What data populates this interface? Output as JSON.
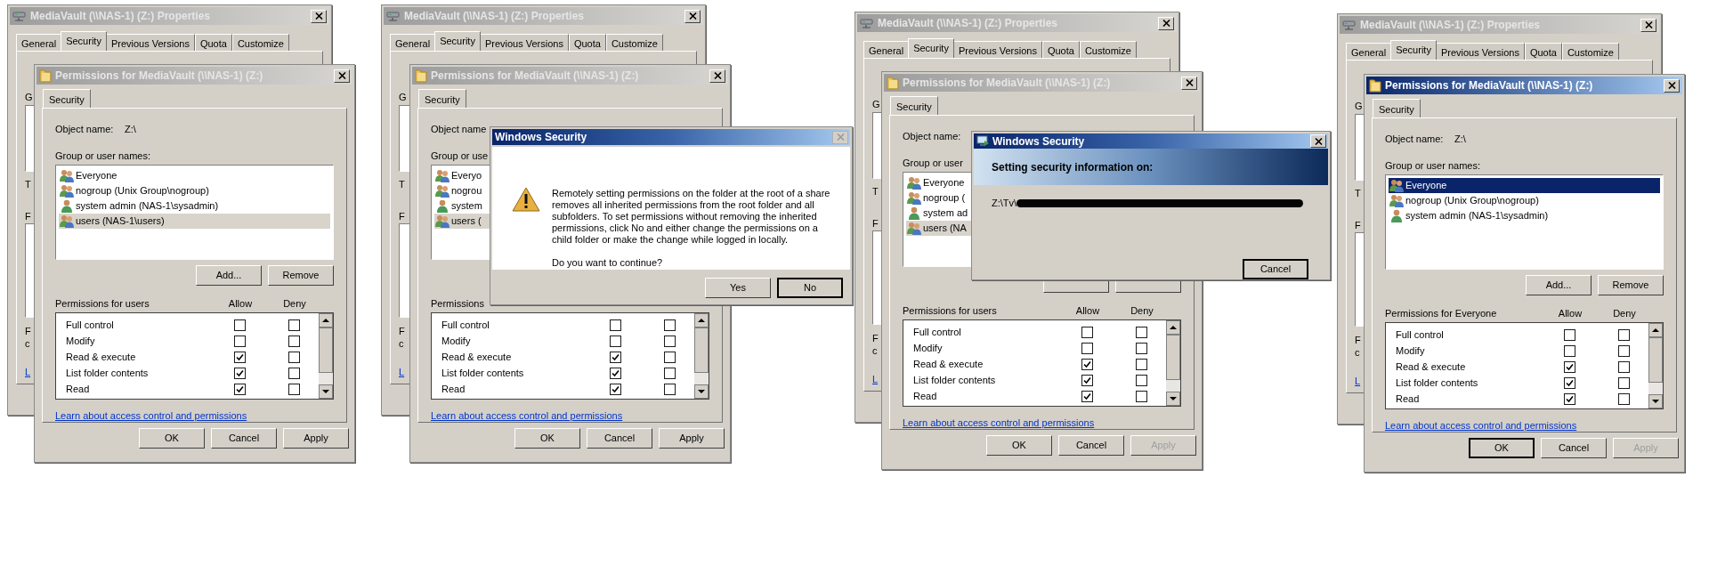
{
  "panels": [
    {
      "properties_window": {
        "title": "MediaVault (\\\\NAS-1) (Z:) Properties",
        "active": false,
        "tabs": [
          {
            "label": "General",
            "selected": false
          },
          {
            "label": "Security",
            "selected": true
          },
          {
            "label": "Previous Versions",
            "selected": false
          },
          {
            "label": "Quota",
            "selected": false
          },
          {
            "label": "Customize",
            "selected": false
          }
        ],
        "fragments": [
          {
            "kind": "label",
            "text": "G"
          },
          {
            "kind": "box"
          },
          {
            "kind": "label",
            "text": "T"
          },
          {
            "kind": "label",
            "text": "F"
          },
          {
            "kind": "box"
          },
          {
            "kind": "label",
            "text": "F"
          },
          {
            "kind": "label",
            "text": "c"
          },
          {
            "kind": "link",
            "text": "L"
          }
        ]
      },
      "permissions_window": {
        "title": "Permissions for MediaVault (\\\\NAS-1) (Z:)",
        "active": false,
        "tab": "Security",
        "object_label": "Object name:",
        "object_value": "Z:\\",
        "group_label": "Group or user names:",
        "users": [
          {
            "name": "Everyone",
            "kind": "group",
            "selected": false
          },
          {
            "name": "nogroup (Unix Group\\nogroup)",
            "kind": "group",
            "selected": false
          },
          {
            "name": "system admin (NAS-1\\sysadmin)",
            "kind": "user",
            "selected": false
          },
          {
            "name": "users (NAS-1\\users)",
            "kind": "group",
            "selected": true
          }
        ],
        "action_buttons": [
          "Add...",
          "Remove"
        ],
        "permissions_label": "Permissions for users",
        "allow_header": "Allow",
        "deny_header": "Deny",
        "permissions": [
          {
            "name": "Full control",
            "allow": false,
            "deny": false
          },
          {
            "name": "Modify",
            "allow": false,
            "deny": false
          },
          {
            "name": "Read & execute",
            "allow": true,
            "deny": false
          },
          {
            "name": "List folder contents",
            "allow": true,
            "deny": false
          },
          {
            "name": "Read",
            "allow": true,
            "deny": false
          }
        ],
        "link": "Learn about access control and permissions",
        "buttons": [
          {
            "label": "OK",
            "default": false,
            "disabled": false
          },
          {
            "label": "Cancel",
            "default": false,
            "disabled": false
          },
          {
            "label": "Apply",
            "default": false,
            "disabled": false
          }
        ]
      }
    },
    {
      "properties_window": {
        "title": "MediaVault (\\\\NAS-1) (Z:) Properties",
        "active": false,
        "tabs": [
          {
            "label": "General",
            "selected": false
          },
          {
            "label": "Security",
            "selected": true
          },
          {
            "label": "Previous Versions",
            "selected": false
          },
          {
            "label": "Quota",
            "selected": false
          },
          {
            "label": "Customize",
            "selected": false
          }
        ],
        "fragments": [
          {
            "kind": "label",
            "text": "G"
          },
          {
            "kind": "box"
          },
          {
            "kind": "label",
            "text": "T"
          },
          {
            "kind": "label",
            "text": "F"
          },
          {
            "kind": "box"
          },
          {
            "kind": "label",
            "text": "F"
          },
          {
            "kind": "label",
            "text": "c"
          },
          {
            "kind": "link",
            "text": "L"
          }
        ]
      },
      "permissions_window": {
        "title": "Permissions for MediaVault (\\\\NAS-1) (Z:)",
        "active": false,
        "tab": "Security",
        "object_label": "Object name",
        "group_label": "Group or use",
        "users": [
          {
            "name": "Everyo",
            "kind": "group",
            "selected": false
          },
          {
            "name": "nogrou",
            "kind": "group",
            "selected": false
          },
          {
            "name": "system",
            "kind": "user",
            "selected": false
          },
          {
            "name": "users (",
            "kind": "group",
            "selected": true
          }
        ],
        "permissions_label": "Permissions",
        "permissions": [
          {
            "name": "Full control",
            "allow": false,
            "deny": false
          },
          {
            "name": "Modify",
            "allow": false,
            "deny": false
          },
          {
            "name": "Read & execute",
            "allow": true,
            "deny": false
          },
          {
            "name": "List folder contents",
            "allow": true,
            "deny": false
          },
          {
            "name": "Read",
            "allow": true,
            "deny": false
          }
        ],
        "link": "Learn about access control and permissions",
        "buttons": [
          {
            "label": "OK",
            "default": false,
            "disabled": false
          },
          {
            "label": "Cancel",
            "default": false,
            "disabled": false
          },
          {
            "label": "Apply",
            "default": false,
            "disabled": false
          }
        ]
      },
      "dialog": {
        "kind": "confirm",
        "title": "Windows Security",
        "message": "Remotely setting permissions on the folder at the root of a share removes all inherited permissions from the root folder and all subfolders. To set permissions without removing the inherited permissions, click No and either change the permissions on a child folder or make the change while logged in locally.",
        "question": "Do you want to continue?",
        "buttons": [
          {
            "label": "Yes",
            "default": false
          },
          {
            "label": "No",
            "default": true
          }
        ]
      }
    },
    {
      "properties_window": {
        "title": "MediaVault (\\\\NAS-1) (Z:) Properties",
        "active": false,
        "tabs": [
          {
            "label": "General",
            "selected": false
          },
          {
            "label": "Security",
            "selected": true
          },
          {
            "label": "Previous Versions",
            "selected": false
          },
          {
            "label": "Quota",
            "selected": false
          },
          {
            "label": "Customize",
            "selected": false
          }
        ],
        "fragments": [
          {
            "kind": "label",
            "text": "G"
          },
          {
            "kind": "box"
          },
          {
            "kind": "label",
            "text": "T"
          },
          {
            "kind": "label",
            "text": "F"
          },
          {
            "kind": "box"
          },
          {
            "kind": "label",
            "text": "F"
          },
          {
            "kind": "label",
            "text": "c"
          },
          {
            "kind": "link",
            "text": "L"
          }
        ]
      },
      "permissions_window": {
        "title": "Permissions for MediaVault (\\\\NAS-1) (Z:)",
        "active": false,
        "tab": "Security",
        "object_label": "Object name:",
        "group_label": "Group or user",
        "users": [
          {
            "name": "Everyone",
            "kind": "group",
            "selected": false
          },
          {
            "name": "nogroup (",
            "kind": "group",
            "selected": false
          },
          {
            "name": "system ad",
            "kind": "user",
            "selected": false
          },
          {
            "name": "users (NA",
            "kind": "group",
            "selected": true
          }
        ],
        "action_button_frames": true,
        "permissions_label": "Permissions for users",
        "allow_header": "Allow",
        "deny_header": "Deny",
        "permissions": [
          {
            "name": "Full control",
            "allow": false,
            "deny": false
          },
          {
            "name": "Modify",
            "allow": false,
            "deny": false
          },
          {
            "name": "Read & execute",
            "allow": true,
            "deny": false
          },
          {
            "name": "List folder contents",
            "allow": true,
            "deny": false
          },
          {
            "name": "Read",
            "allow": true,
            "deny": false
          }
        ],
        "link": "Learn about access control and permissions",
        "buttons": [
          {
            "label": "OK",
            "default": false,
            "disabled": false
          },
          {
            "label": "Cancel",
            "default": false,
            "disabled": false
          },
          {
            "label": "Apply",
            "default": false,
            "disabled": true
          }
        ]
      },
      "dialog": {
        "kind": "progress",
        "title": "Windows Security",
        "heading": "Setting security information on:",
        "path": "Z:\\Tv\\",
        "buttons": [
          {
            "label": "Cancel",
            "default": true
          }
        ]
      }
    },
    {
      "properties_window": {
        "title": "MediaVault (\\\\NAS-1) (Z:) Properties",
        "active": false,
        "tabs": [
          {
            "label": "General",
            "selected": false
          },
          {
            "label": "Security",
            "selected": true
          },
          {
            "label": "Previous Versions",
            "selected": false
          },
          {
            "label": "Quota",
            "selected": false
          },
          {
            "label": "Customize",
            "selected": false
          }
        ],
        "fragments": [
          {
            "kind": "label",
            "text": "G"
          },
          {
            "kind": "box"
          },
          {
            "kind": "label",
            "text": "T"
          },
          {
            "kind": "label",
            "text": "F"
          },
          {
            "kind": "box"
          },
          {
            "kind": "label",
            "text": "F"
          },
          {
            "kind": "label",
            "text": "c"
          },
          {
            "kind": "link",
            "text": "L"
          }
        ]
      },
      "permissions_window": {
        "title": "Permissions for MediaVault (\\\\NAS-1) (Z:)",
        "active": true,
        "tab": "Security",
        "object_label": "Object name:",
        "object_value": "Z:\\",
        "group_label": "Group or user names:",
        "users": [
          {
            "name": "Everyone",
            "kind": "group",
            "selected": true
          },
          {
            "name": "nogroup (Unix Group\\nogroup)",
            "kind": "group",
            "selected": false
          },
          {
            "name": "system admin (NAS-1\\sysadmin)",
            "kind": "user",
            "selected": false
          }
        ],
        "action_buttons": [
          "Add...",
          "Remove"
        ],
        "permissions_label": "Permissions for Everyone",
        "allow_header": "Allow",
        "deny_header": "Deny",
        "permissions": [
          {
            "name": "Full control",
            "allow": false,
            "deny": false
          },
          {
            "name": "Modify",
            "allow": false,
            "deny": false
          },
          {
            "name": "Read & execute",
            "allow": true,
            "deny": false
          },
          {
            "name": "List folder contents",
            "allow": true,
            "deny": false
          },
          {
            "name": "Read",
            "allow": true,
            "deny": false
          }
        ],
        "link": "Learn about access control and permissions",
        "buttons": [
          {
            "label": "OK",
            "default": true,
            "disabled": false
          },
          {
            "label": "Cancel",
            "default": false,
            "disabled": false
          },
          {
            "label": "Apply",
            "default": false,
            "disabled": true
          }
        ]
      }
    }
  ]
}
